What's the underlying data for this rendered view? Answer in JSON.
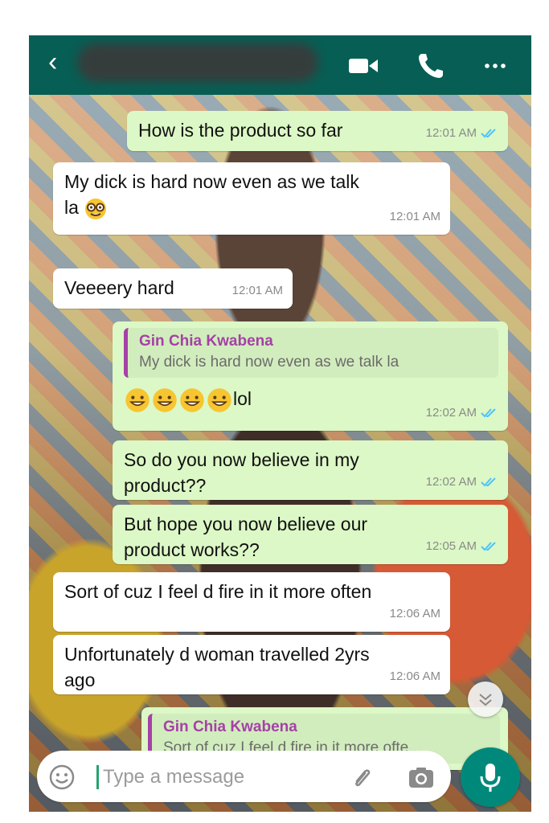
{
  "header": {
    "back_glyph": "‹"
  },
  "messages": [
    {
      "text": "How is the product so far",
      "time": "12:01 AM",
      "direction": "out"
    },
    {
      "text": "My dick is hard now even as we talk",
      "text2": "la",
      "time": "12:01 AM",
      "direction": "in",
      "emoji": "nerd-face"
    },
    {
      "text": "Veeeery hard",
      "time": "12:01 AM",
      "direction": "in"
    },
    {
      "reply_name": "Gin Chia Kwabena",
      "reply_text": "My dick is hard now even as we talk la",
      "text": "lol",
      "time": "12:02 AM",
      "direction": "out",
      "emoji": "grinning-face ×4"
    },
    {
      "text": "So do you now believe in my",
      "text2": "product??",
      "time": "12:02 AM",
      "direction": "out"
    },
    {
      "text": "But hope you now believe our",
      "text2": "product works??",
      "time": "12:05 AM",
      "direction": "out"
    },
    {
      "text": "Sort of cuz I feel d fire in it more often",
      "time": "12:06 AM",
      "direction": "in"
    },
    {
      "text": "Unfortunately d woman travelled 2yrs",
      "text2": "ago",
      "time": "12:06 AM",
      "direction": "in"
    },
    {
      "reply_name": "Gin Chia Kwabena",
      "reply_text": "Sort of cuz I feel d fire in it more ofte...",
      "direction": "out"
    }
  ],
  "composer": {
    "placeholder": "Type a message"
  },
  "colors": {
    "header": "#075e54",
    "outgoing_bubble": "#dcf8c6",
    "incoming_bubble": "#ffffff",
    "read_ticks": "#4fc3f7",
    "reply_accent": "#a541a7",
    "mic_button": "#00897b"
  }
}
